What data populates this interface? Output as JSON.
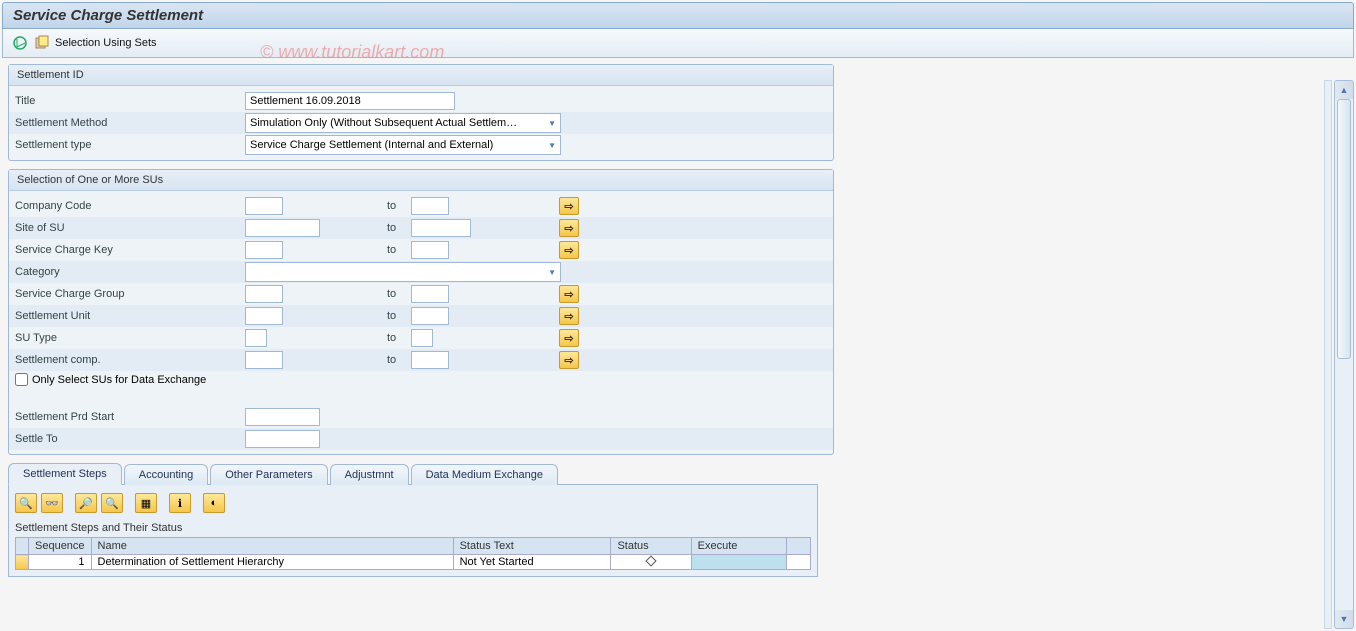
{
  "title": "Service Charge Settlement",
  "toolbar": {
    "selection_using_sets": "Selection Using Sets"
  },
  "watermark": "© www.tutorialkart.com",
  "group_settlement_id": {
    "title": "Settlement ID",
    "rows": {
      "title_label": "Title",
      "title_value": "Settlement 16.09.2018",
      "method_label": "Settlement Method",
      "method_value": "Simulation Only (Without Subsequent Actual Settlem…",
      "type_label": "Settlement type",
      "type_value": "Service Charge Settlement (Internal and External)"
    }
  },
  "group_su": {
    "title": "Selection of One or More SUs",
    "labels": {
      "company_code": "Company Code",
      "site_of_su": "Site of SU",
      "service_charge_key": "Service Charge Key",
      "category": "Category",
      "service_charge_group": "Service Charge Group",
      "settlement_unit": "Settlement Unit",
      "su_type": "SU Type",
      "settlement_comp": "Settlement comp.",
      "only_select": "Only Select SUs for Data Exchange",
      "period_start": "Settlement Prd Start",
      "settle_to": "Settle To",
      "to": "to"
    },
    "category_value": ""
  },
  "tabs": {
    "settlement_steps": "Settlement Steps",
    "accounting": "Accounting",
    "other_parameters": "Other Parameters",
    "adjustment": "Adjustmnt",
    "data_medium": "Data Medium Exchange"
  },
  "panel": {
    "subtitle": "Settlement Steps and Their Status",
    "cols": {
      "sequence": "Sequence",
      "name": "Name",
      "status_text": "Status Text",
      "status": "Status",
      "execute": "Execute"
    },
    "row1": {
      "sequence": "1",
      "name": "Determination of Settlement Hierarchy",
      "status_text": "Not Yet Started",
      "status": "",
      "execute": ""
    }
  }
}
